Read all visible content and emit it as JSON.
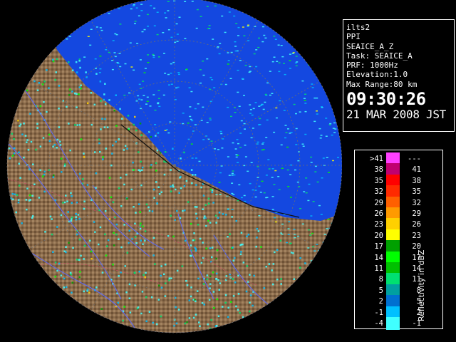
{
  "radar": {
    "radar_name": "ilts2",
    "scan_type": "PPI",
    "product": "SEAICE_A_Z",
    "task": "Task: SEAICE_A",
    "prf": "PRF: 1000Hz",
    "elevation": "Elevation:1.0",
    "max_range": "Max Range:80 km",
    "time": "09:30:26",
    "date": "21 MAR 2008 JST"
  },
  "legend": {
    "unit": "Reflectivity in dBZ",
    "bins": [
      {
        "lo": ">41",
        "hi": "---",
        "color": "#ff40ff"
      },
      {
        "lo": "38",
        "hi": "41",
        "color": "#c00070"
      },
      {
        "lo": "35",
        "hi": "38",
        "color": "#ff0000"
      },
      {
        "lo": "32",
        "hi": "35",
        "color": "#ff2a00"
      },
      {
        "lo": "29",
        "hi": "32",
        "color": "#ff6000"
      },
      {
        "lo": "26",
        "hi": "29",
        "color": "#ff9a00"
      },
      {
        "lo": "23",
        "hi": "26",
        "color": "#ffd000"
      },
      {
        "lo": "20",
        "hi": "23",
        "color": "#ffff00"
      },
      {
        "lo": "17",
        "hi": "20",
        "color": "#00a000"
      },
      {
        "lo": "14",
        "hi": "17",
        "color": "#00ff00"
      },
      {
        "lo": "11",
        "hi": "14",
        "color": "#00c000"
      },
      {
        "lo": "8",
        "hi": "11",
        "color": "#00e070"
      },
      {
        "lo": "5",
        "hi": "8",
        "color": "#00a0a0"
      },
      {
        "lo": "2",
        "hi": "5",
        "color": "#0070d0"
      },
      {
        "lo": "-1",
        "hi": "2",
        "color": "#00c0ff"
      },
      {
        "lo": "-4",
        "hi": "-1",
        "color": "#40ffff"
      }
    ]
  },
  "map_colors": {
    "sea": "#1448e0",
    "land": "#8a6a4a",
    "outside": "#000000",
    "rivers": "#5a6aff",
    "roads": "#c05060"
  }
}
